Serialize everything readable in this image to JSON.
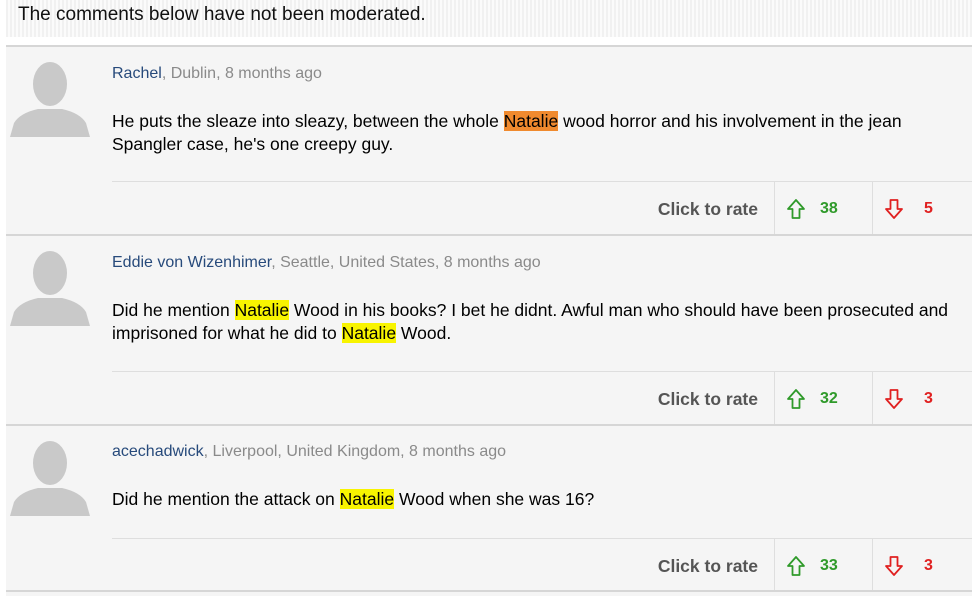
{
  "notice": "The comments below have not been moderated.",
  "rate_label": "Click to rate",
  "comments": [
    {
      "author": "Rachel",
      "location_time": ", Dublin, 8 months ago",
      "text": [
        {
          "t": "He puts the sleaze into sleazy, between the whole ",
          "hl": ""
        },
        {
          "t": "Natalie",
          "hl": "orange"
        },
        {
          "t": " wood horror and his involvement in the jean Spangler case, he's one creepy guy.",
          "hl": ""
        }
      ],
      "up": "38",
      "down": "5"
    },
    {
      "author": "Eddie von Wizenhimer",
      "location_time": ", Seattle, United States, 8 months ago",
      "text": [
        {
          "t": "Did he mention ",
          "hl": ""
        },
        {
          "t": "Natalie",
          "hl": "yellow"
        },
        {
          "t": " Wood in his books? I bet he didnt. Awful man who should have been prosecuted and imprisoned for what he did to ",
          "hl": ""
        },
        {
          "t": "Natalie",
          "hl": "yellow"
        },
        {
          "t": " Wood.",
          "hl": ""
        }
      ],
      "up": "32",
      "down": "3"
    },
    {
      "author": "acechadwick",
      "location_time": ", Liverpool, United Kingdom, 8 months ago",
      "text": [
        {
          "t": "Did he mention the attack on ",
          "hl": ""
        },
        {
          "t": "Natalie",
          "hl": "yellow"
        },
        {
          "t": " Wood when she was 16?",
          "hl": ""
        }
      ],
      "up": "33",
      "down": "3"
    }
  ]
}
